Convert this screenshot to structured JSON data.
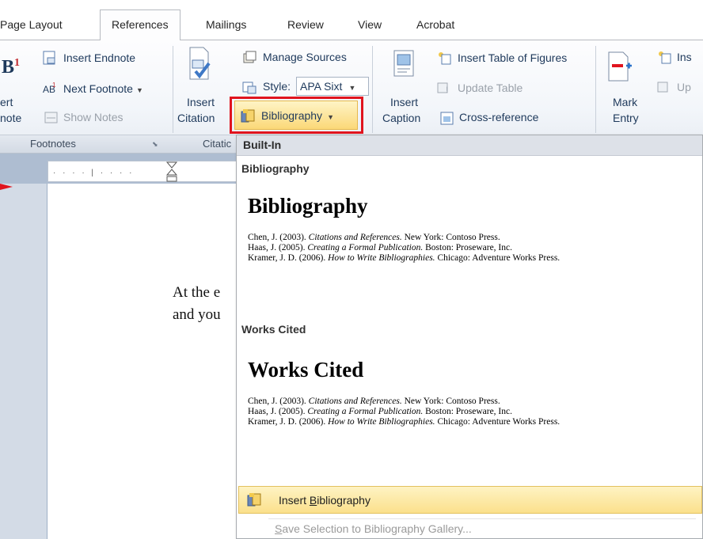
{
  "tabs": [
    "Page Layout",
    "References",
    "Mailings",
    "Review",
    "View",
    "Acrobat"
  ],
  "active_tab": "References",
  "ribbon": {
    "insert_endnote": "Insert Endnote",
    "next_footnote": "Next Footnote",
    "show_notes": "Show Notes",
    "insert_footnote_line1": "ert",
    "insert_footnote_line2": "note",
    "footnote_glyph": "B",
    "footnote_sup": "1",
    "manage_sources": "Manage Sources",
    "style_label": "Style:",
    "style_value": "APA Sixt",
    "bibliography": "Bibliography",
    "insert_citation_line1": "Insert",
    "insert_citation_line2": "Citation",
    "insert_caption_line1": "Insert",
    "insert_caption_line2": "Caption",
    "insert_table_of_figures": "Insert Table of Figures",
    "update_table": "Update Table",
    "cross_reference": "Cross-reference",
    "mark_entry_line1": "Mark",
    "mark_entry_line2": "Entry",
    "ins_partial": "Ins",
    "up_partial": "Up"
  },
  "group_labels": {
    "footnotes": "Footnotes",
    "citations_partial": "Citatic"
  },
  "document": {
    "line1": "At the e",
    "line2": "and you"
  },
  "dropdown": {
    "header": "Built-In",
    "sections": [
      {
        "label": "Bibliography",
        "title": "Bibliography",
        "references": [
          {
            "author": "Chen, J. (2003).",
            "title": "Citations and References.",
            "pub": "New York: Contoso Press."
          },
          {
            "author": "Haas, J. (2005).",
            "title": "Creating a Formal Publication.",
            "pub": "Boston: Proseware, Inc."
          },
          {
            "author": "Kramer, J. D. (2006).",
            "title": "How to Write Bibliographies.",
            "pub": "Chicago: Adventure Works Press."
          }
        ]
      },
      {
        "label": "Works Cited",
        "title": "Works Cited",
        "references": [
          {
            "author": "Chen, J. (2003).",
            "title": "Citations and References.",
            "pub": "New York: Contoso Press."
          },
          {
            "author": "Haas, J. (2005).",
            "title": "Creating a Formal Publication.",
            "pub": "Boston: Proseware, Inc."
          },
          {
            "author": "Kramer, J. D. (2006).",
            "title": "How to Write Bibliographies.",
            "pub": "Chicago: Adventure Works Press."
          }
        ]
      }
    ],
    "insert_bibliography_pre": "Insert ",
    "insert_bibliography_ul": "B",
    "insert_bibliography_post": "ibliography",
    "save_selection_ul": "S",
    "save_selection_post": "ave Selection to Bibliography Gallery..."
  },
  "colors": {
    "highlight": "#e0141e",
    "hover": "#fbe08c",
    "ribbon_text": "#1e395b"
  }
}
